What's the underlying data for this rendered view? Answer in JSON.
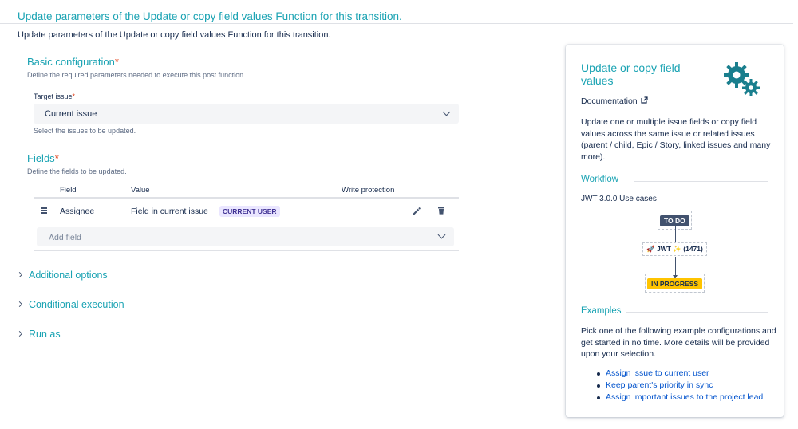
{
  "header": {
    "title": "Update parameters of the Update or copy field values Function for this transition.",
    "description": "Update parameters of the Update or copy field values Function for this transition."
  },
  "basic_config": {
    "title": "Basic configuration",
    "required_mark": "*",
    "subtitle": "Define the required parameters needed to execute this post function.",
    "target_issue": {
      "label": "Target issue",
      "required_mark": "*",
      "value": "Current issue",
      "help": "Select the issues to be updated."
    }
  },
  "fields": {
    "title": "Fields",
    "required_mark": "*",
    "subtitle": "Define the fields to be updated.",
    "columns": [
      "Field",
      "Value",
      "Write protection"
    ],
    "rows": [
      {
        "field": "Assignee",
        "value": "Field in current issue",
        "badge": "CURRENT USER"
      }
    ],
    "add_placeholder": "Add field"
  },
  "collapsibles": [
    "Additional options",
    "Conditional execution",
    "Run as"
  ],
  "panel": {
    "title": "Update or copy field values",
    "doc_link": "Documentation",
    "description": "Update one or multiple issue fields or copy field values across the same issue or related issues (parent / child, Epic / Story, linked issues and many more).",
    "workflow_heading": "Workflow",
    "workflow_name": "JWT 3.0.0 Use cases",
    "status_from": "TO DO",
    "transition_label": "JWT",
    "transition_count": "(1471)",
    "status_to": "IN PROGRESS",
    "examples_heading": "Examples",
    "examples_desc": "Pick one of the following example configurations and get started in no time. More details will be provided upon your selection.",
    "examples": [
      "Assign issue to current user",
      "Keep parent's priority in sync",
      "Assign important issues to the project lead"
    ]
  },
  "colors": {
    "accent": "#1aa3b3",
    "link": "#0052cc",
    "required": "#de350b",
    "lozenge_bg": "#eae6ff",
    "lozenge_text": "#403294",
    "todo_bg": "#42526e",
    "inprogress_bg": "#ffc400"
  },
  "icons": {
    "drag": "drag-handle-icon",
    "edit": "pencil-icon",
    "delete": "trash-icon",
    "external": "external-link-icon",
    "gears": "gears-icon",
    "rocket": "rocket-icon",
    "wand": "magic-wand-icon"
  }
}
